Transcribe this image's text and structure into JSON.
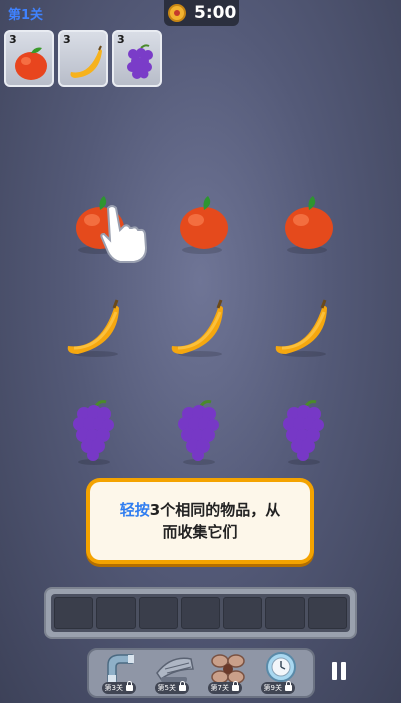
{
  "header": {
    "level_label": "第1关",
    "timer": "5:00"
  },
  "goals": [
    {
      "count": "3",
      "icon": "apple-icon"
    },
    {
      "count": "3",
      "icon": "banana-icon"
    },
    {
      "count": "3",
      "icon": "grapes-icon"
    }
  ],
  "board": {
    "rows": [
      [
        "apple",
        "apple",
        "apple"
      ],
      [
        "banana",
        "banana",
        "banana"
      ],
      [
        "grapes",
        "grapes",
        "grapes"
      ]
    ]
  },
  "tip": {
    "highlight": "轻按",
    "line1_rest": "3个相同的物品，从",
    "line2": "而收集它们"
  },
  "tray": {
    "slot_count": 7
  },
  "tools": [
    {
      "label": "第3关",
      "icon": "magnet-icon"
    },
    {
      "label": "第5关",
      "icon": "fan-icon"
    },
    {
      "label": "第7关",
      "icon": "propeller-icon"
    },
    {
      "label": "第9关",
      "icon": "freeze-clock-icon"
    }
  ],
  "colors": {
    "accent_blue": "#3f82ff",
    "tip_border": "#f4a300"
  }
}
